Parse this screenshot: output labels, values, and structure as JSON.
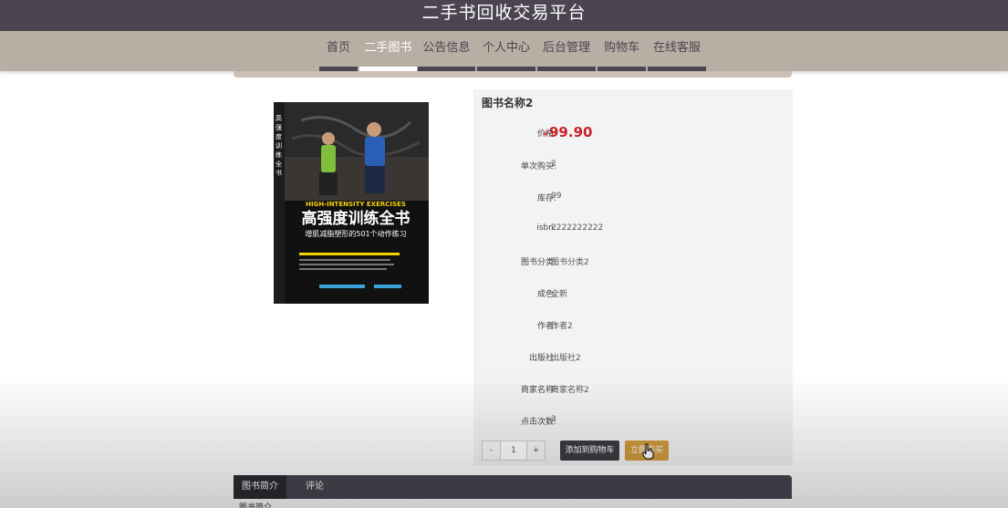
{
  "header": {
    "title": "二手书回收交易平台"
  },
  "nav": {
    "items": [
      {
        "label": "首页",
        "active": false
      },
      {
        "label": "二手图书",
        "active": true
      },
      {
        "label": "公告信息",
        "active": false
      },
      {
        "label": "个人中心",
        "active": false
      },
      {
        "label": "后台管理",
        "active": false
      },
      {
        "label": "购物车",
        "active": false
      },
      {
        "label": "在线客服",
        "active": false
      }
    ]
  },
  "cover": {
    "series_title": "高强度训练全书",
    "subtitle_en": "HIGH-INTENSITY EXERCISES",
    "main_title": "高强度训练全书",
    "subtitle_cn": "增肌减脂塑形的501个动作练习"
  },
  "book": {
    "name": "图书名称2",
    "price_label": "价格:",
    "currency": "¥",
    "price": "99.90",
    "fields": [
      {
        "label": "单次购买:",
        "value": "2"
      },
      {
        "label": "库存:",
        "value": "99"
      },
      {
        "label": "isbn:",
        "value": "2222222222"
      },
      {
        "label": "图书分类:",
        "value": "图书分类2"
      },
      {
        "label": "成色:",
        "value": "全新"
      },
      {
        "label": "作者:",
        "value": "作者2"
      },
      {
        "label": "出版社:",
        "value": "出版社2"
      },
      {
        "label": "商家名称:",
        "value": "商家名称2"
      },
      {
        "label": "点击次数:",
        "value": "3"
      }
    ]
  },
  "purchase": {
    "minus": "-",
    "quantity": "1",
    "plus": "+",
    "add_to_cart": "添加到购物车",
    "buy_now": "立即购买"
  },
  "tabs": {
    "items": [
      {
        "label": "图书简介"
      },
      {
        "label": "评论"
      }
    ],
    "content_heading": "图书简介"
  },
  "colors": {
    "header_bg": "#4a4550",
    "nav_bg": "#b9aea4",
    "price": "#c9222a",
    "buy_button": "#d19a3f",
    "cart_button": "#3e3a42"
  }
}
